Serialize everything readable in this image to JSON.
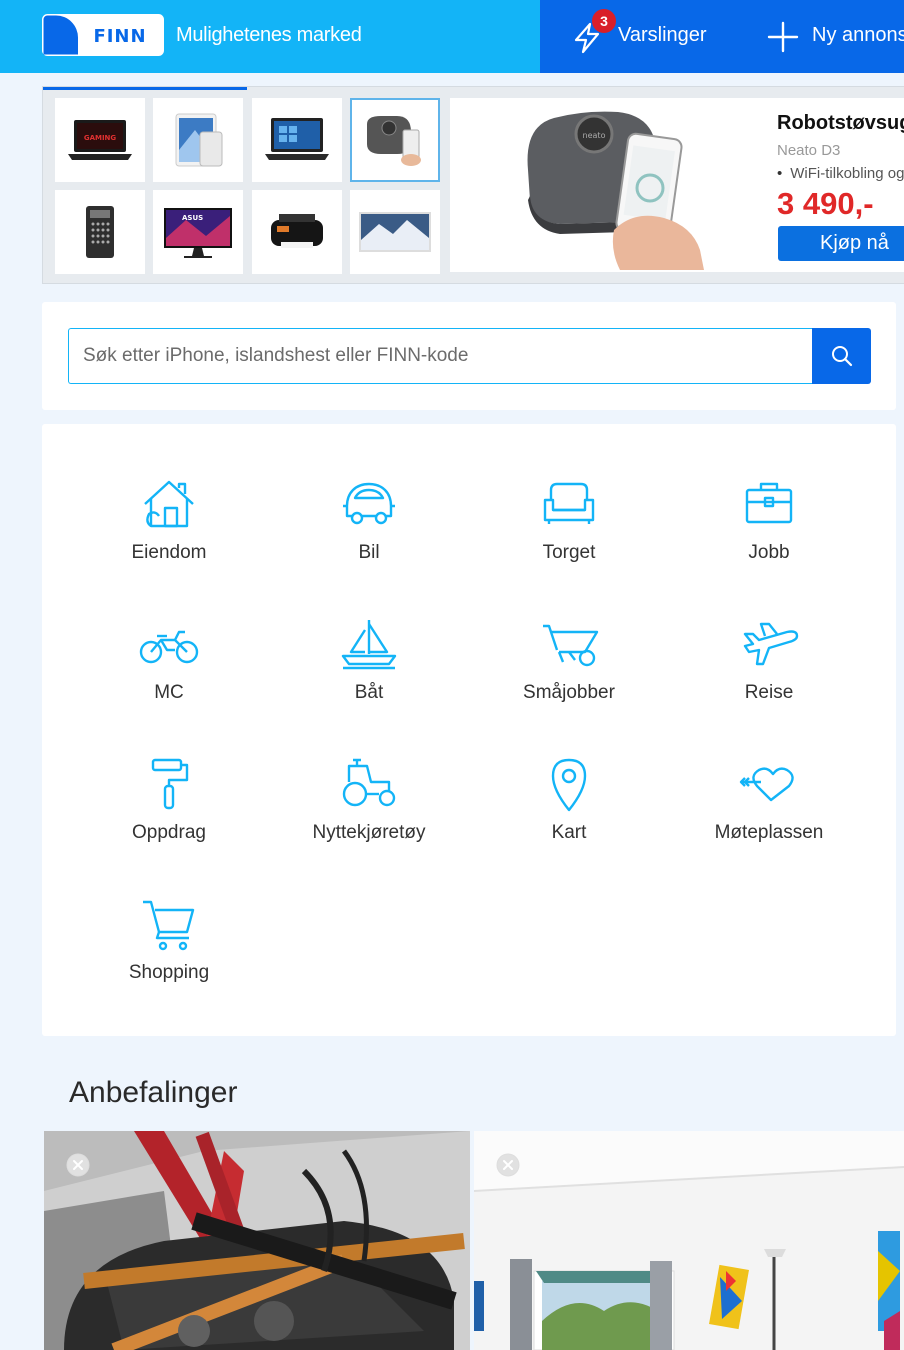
{
  "header": {
    "logo_text": "FINN",
    "tagline": "Mulighetenes marked",
    "notifications_label": "Varslinger",
    "notifications_count": "3",
    "new_ad_label": "Ny annonse"
  },
  "banner": {
    "thumbnails": [
      "laptop",
      "tablet",
      "laptop",
      "robot-vacuum",
      "radio",
      "monitor",
      "printer",
      "tv"
    ],
    "selected_thumbnail": 3,
    "product_title": "Robotstøvsuger",
    "product_subtitle": "Neato D3",
    "product_bullet": "WiFi-tilkobling og app",
    "price": "3 490,-",
    "buy_label": "Kjøp nå"
  },
  "search": {
    "placeholder": "Søk etter iPhone, islandshest eller FINN-kode"
  },
  "categories": [
    {
      "label": "Eiendom",
      "icon": "house-icon"
    },
    {
      "label": "Bil",
      "icon": "car-icon"
    },
    {
      "label": "Torget",
      "icon": "sofa-icon"
    },
    {
      "label": "Jobb",
      "icon": "briefcase-icon"
    },
    {
      "label": "MC",
      "icon": "motorcycle-icon"
    },
    {
      "label": "Båt",
      "icon": "sailboat-icon"
    },
    {
      "label": "Småjobber",
      "icon": "wheelbarrow-icon"
    },
    {
      "label": "Reise",
      "icon": "airplane-icon"
    },
    {
      "label": "Oppdrag",
      "icon": "paint-roller-icon"
    },
    {
      "label": "Nyttekjøretøy",
      "icon": "tractor-icon"
    },
    {
      "label": "Kart",
      "icon": "map-pin-icon"
    },
    {
      "label": "Møteplassen",
      "icon": "heart-arrow-icon"
    },
    {
      "label": "Shopping",
      "icon": "shopping-cart-icon"
    }
  ],
  "recommendations": {
    "title": "Anbefalinger"
  },
  "colors": {
    "header_blue": "#13b4f7",
    "header_dark_blue": "#0868e8",
    "price_red": "#e02828",
    "icon_blue": "#13b4f7",
    "page_bg": "#eef5fd"
  }
}
